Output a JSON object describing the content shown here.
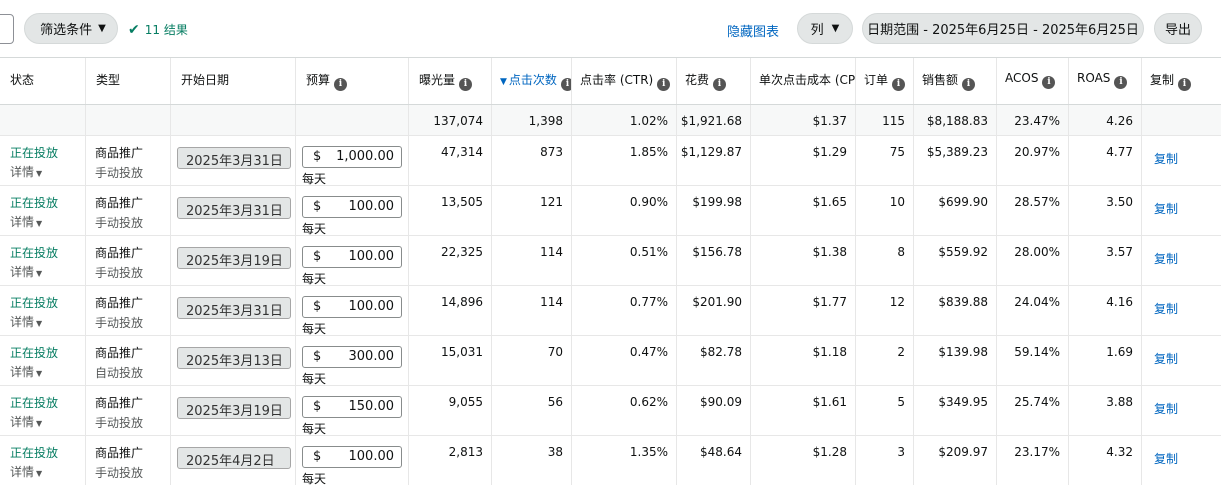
{
  "toolbar": {
    "filter_label": "筛选条件",
    "result_text": "11 结果",
    "hide_chart": "隐藏图表",
    "columns_label": "列",
    "date_range": "日期范围 - 2025年6月25日 - 2025年6月25日",
    "export_label": "导出"
  },
  "headers": {
    "status": "状态",
    "type": "类型",
    "start_date": "开始日期",
    "budget": "预算",
    "impressions": "曝光量",
    "clicks": "点击次数",
    "ctr": "点击率 (CTR)",
    "spend": "花费",
    "cpc": "单次点击成本 (CPC",
    "orders": "订单",
    "sales": "销售额",
    "acos": "ACOS",
    "roas": "ROAS",
    "copy": "复制"
  },
  "totals": {
    "impressions": "137,074",
    "clicks": "1,398",
    "ctr": "1.02%",
    "spend": "$1,921.68",
    "cpc": "$1.37",
    "orders": "115",
    "sales": "$8,188.83",
    "acos": "23.47%",
    "roas": "4.26"
  },
  "rows": [
    {
      "status": "正在投放",
      "details": "详情",
      "type": "商品推广",
      "targeting": "手动投放",
      "start_date": "2025年3月31日",
      "currency": "$",
      "budget": "1,000.00",
      "per_day": "每天",
      "impressions": "47,314",
      "clicks": "873",
      "ctr": "1.85%",
      "spend": "$1,129.87",
      "cpc": "$1.29",
      "orders": "75",
      "sales": "$5,389.23",
      "acos": "20.97%",
      "roas": "4.77",
      "copy": "复制"
    },
    {
      "status": "正在投放",
      "details": "详情",
      "type": "商品推广",
      "targeting": "手动投放",
      "start_date": "2025年3月31日",
      "currency": "$",
      "budget": "100.00",
      "per_day": "每天",
      "impressions": "13,505",
      "clicks": "121",
      "ctr": "0.90%",
      "spend": "$199.98",
      "cpc": "$1.65",
      "orders": "10",
      "sales": "$699.90",
      "acos": "28.57%",
      "roas": "3.50",
      "copy": "复制"
    },
    {
      "status": "正在投放",
      "details": "详情",
      "type": "商品推广",
      "targeting": "手动投放",
      "start_date": "2025年3月19日",
      "currency": "$",
      "budget": "100.00",
      "per_day": "每天",
      "impressions": "22,325",
      "clicks": "114",
      "ctr": "0.51%",
      "spend": "$156.78",
      "cpc": "$1.38",
      "orders": "8",
      "sales": "$559.92",
      "acos": "28.00%",
      "roas": "3.57",
      "copy": "复制"
    },
    {
      "status": "正在投放",
      "details": "详情",
      "type": "商品推广",
      "targeting": "手动投放",
      "start_date": "2025年3月31日",
      "currency": "$",
      "budget": "100.00",
      "per_day": "每天",
      "impressions": "14,896",
      "clicks": "114",
      "ctr": "0.77%",
      "spend": "$201.90",
      "cpc": "$1.77",
      "orders": "12",
      "sales": "$839.88",
      "acos": "24.04%",
      "roas": "4.16",
      "copy": "复制"
    },
    {
      "status": "正在投放",
      "details": "详情",
      "type": "商品推广",
      "targeting": "自动投放",
      "start_date": "2025年3月13日",
      "currency": "$",
      "budget": "300.00",
      "per_day": "每天",
      "impressions": "15,031",
      "clicks": "70",
      "ctr": "0.47%",
      "spend": "$82.78",
      "cpc": "$1.18",
      "orders": "2",
      "sales": "$139.98",
      "acos": "59.14%",
      "roas": "1.69",
      "copy": "复制"
    },
    {
      "status": "正在投放",
      "details": "详情",
      "type": "商品推广",
      "targeting": "手动投放",
      "start_date": "2025年3月19日",
      "currency": "$",
      "budget": "150.00",
      "per_day": "每天",
      "impressions": "9,055",
      "clicks": "56",
      "ctr": "0.62%",
      "spend": "$90.09",
      "cpc": "$1.61",
      "orders": "5",
      "sales": "$349.95",
      "acos": "25.74%",
      "roas": "3.88",
      "copy": "复制"
    },
    {
      "status": "正在投放",
      "details": "详情",
      "type": "商品推广",
      "targeting": "手动投放",
      "start_date": "2025年4月2日",
      "currency": "$",
      "budget": "100.00",
      "per_day": "每天",
      "impressions": "2,813",
      "clicks": "38",
      "ctr": "1.35%",
      "spend": "$48.64",
      "cpc": "$1.28",
      "orders": "3",
      "sales": "$209.97",
      "acos": "23.17%",
      "roas": "4.32",
      "copy": "复制"
    }
  ]
}
